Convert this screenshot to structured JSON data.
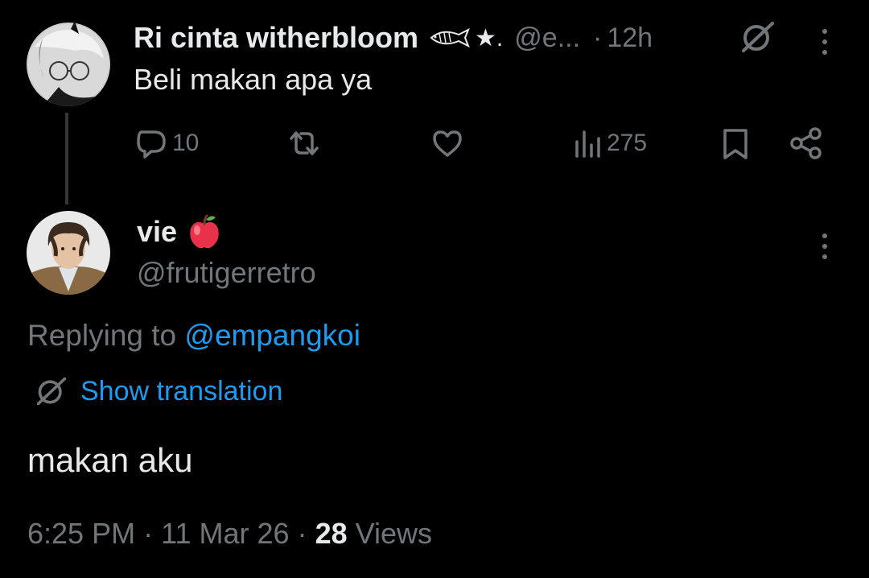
{
  "parent": {
    "display_name": "Ri cinta witherbloom",
    "name_suffix": "★.",
    "handle": "@e...",
    "time_sep": "·",
    "time": "12h",
    "text": "Beli makan apa ya",
    "actions": {
      "replies": "10",
      "retweets": "",
      "likes": "",
      "views": "275"
    }
  },
  "tweet": {
    "display_name": "vie",
    "handle": "@frutigerretro",
    "replying_label": "Replying to",
    "replying_handle": "@empangkoi",
    "show_translation": "Show translation",
    "text": "makan aku",
    "time": "6:25 PM",
    "sep1": "·",
    "date": "11 Mar 26",
    "sep2": "·",
    "views_count": "28",
    "views_label": "Views"
  },
  "colors": {
    "background": "#000000",
    "text": "#e7e9ea",
    "muted": "#71767b",
    "link": "#1d9bf0",
    "thread_line": "#333639"
  },
  "icons": [
    "grok-translate-icon",
    "more-icon",
    "reply-icon",
    "retweet-icon",
    "like-icon",
    "views-icon",
    "bookmark-icon",
    "share-icon",
    "apple-emoji",
    "fish-emoji"
  ]
}
